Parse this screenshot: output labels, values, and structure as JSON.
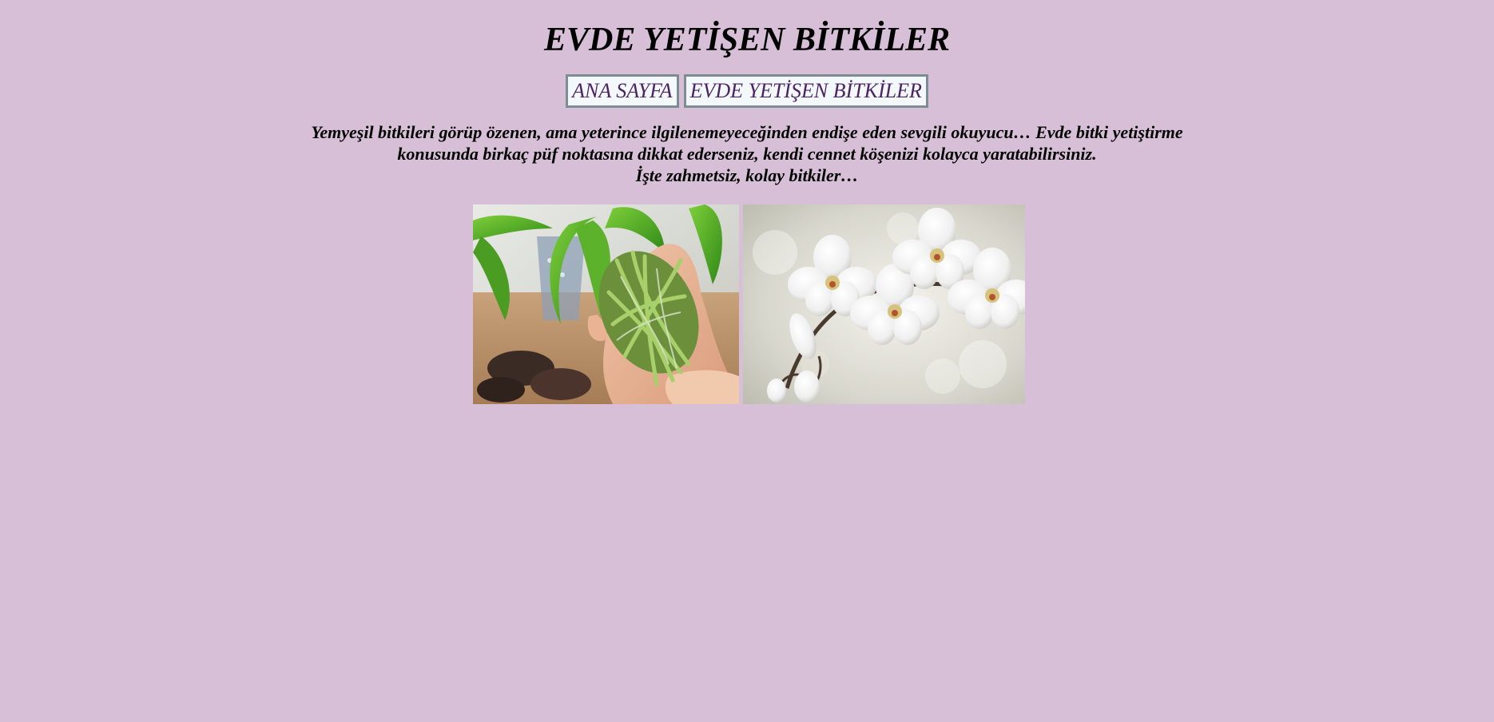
{
  "page": {
    "title": "EVDE YETİŞEN BİTKİLER"
  },
  "nav": {
    "items": [
      {
        "label": "ANA SAYFA"
      },
      {
        "label": "EVDE YETİŞEN BİTKİLER"
      }
    ]
  },
  "intro": {
    "line1": "Yemyeşil bitkileri görüp özenen, ama yeterince ilgilenemeyeceğinden endişe eden sevgili okuyucu… Evde bitki yetiştirme",
    "line2": "konusunda birkaç püf noktasına dikkat ederseniz, kendi cennet köşenizi kolayca yaratabilirsiniz.",
    "line3": "İşte zahmetsiz, kolay bitkiler…"
  },
  "gallery": {
    "images": [
      {
        "name": "orchid-roots-photo"
      },
      {
        "name": "white-orchid-photo"
      }
    ]
  },
  "colors": {
    "background": "#d8bfd8",
    "nav_background": "#f3f8fb",
    "nav_border": "#7d8d93",
    "nav_text": "#4b2366"
  }
}
